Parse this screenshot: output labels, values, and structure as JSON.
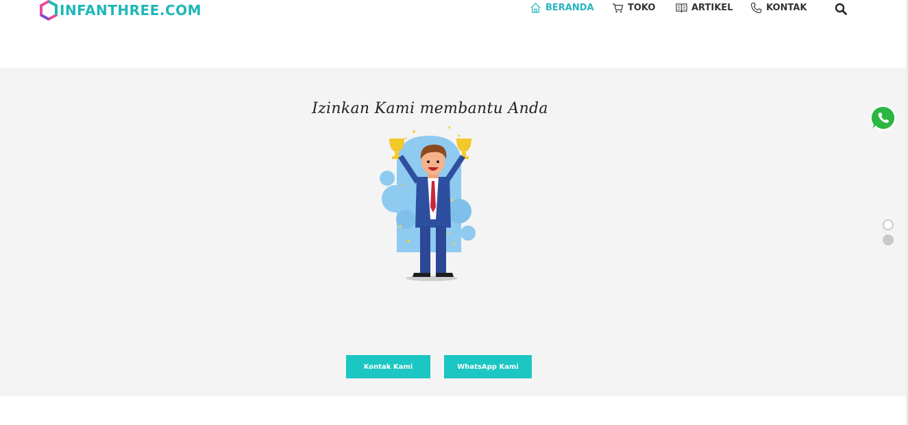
{
  "header": {
    "logo_text": "INFANTHREE.COM",
    "nav": [
      {
        "label": "BERANDA",
        "icon": "home-icon",
        "active": true
      },
      {
        "label": "TOKO",
        "icon": "cart-icon",
        "active": false
      },
      {
        "label": "ARTIKEL",
        "icon": "book-icon",
        "active": false
      },
      {
        "label": "KONTAK",
        "icon": "phone-icon",
        "active": false
      }
    ],
    "search_icon": "search-icon"
  },
  "hero": {
    "headline": "Izinkan Kami membantu Anda",
    "buttons": {
      "kontak": "Kontak Kami",
      "whatsapp": "WhatsApp Kami"
    }
  },
  "floating": {
    "whatsapp_icon": "whatsapp-icon",
    "slider_dots": 2
  },
  "colors": {
    "accent": "#1cc6c3",
    "nav_active": "#27b4bf",
    "hero_bg": "#f4f4f4"
  }
}
